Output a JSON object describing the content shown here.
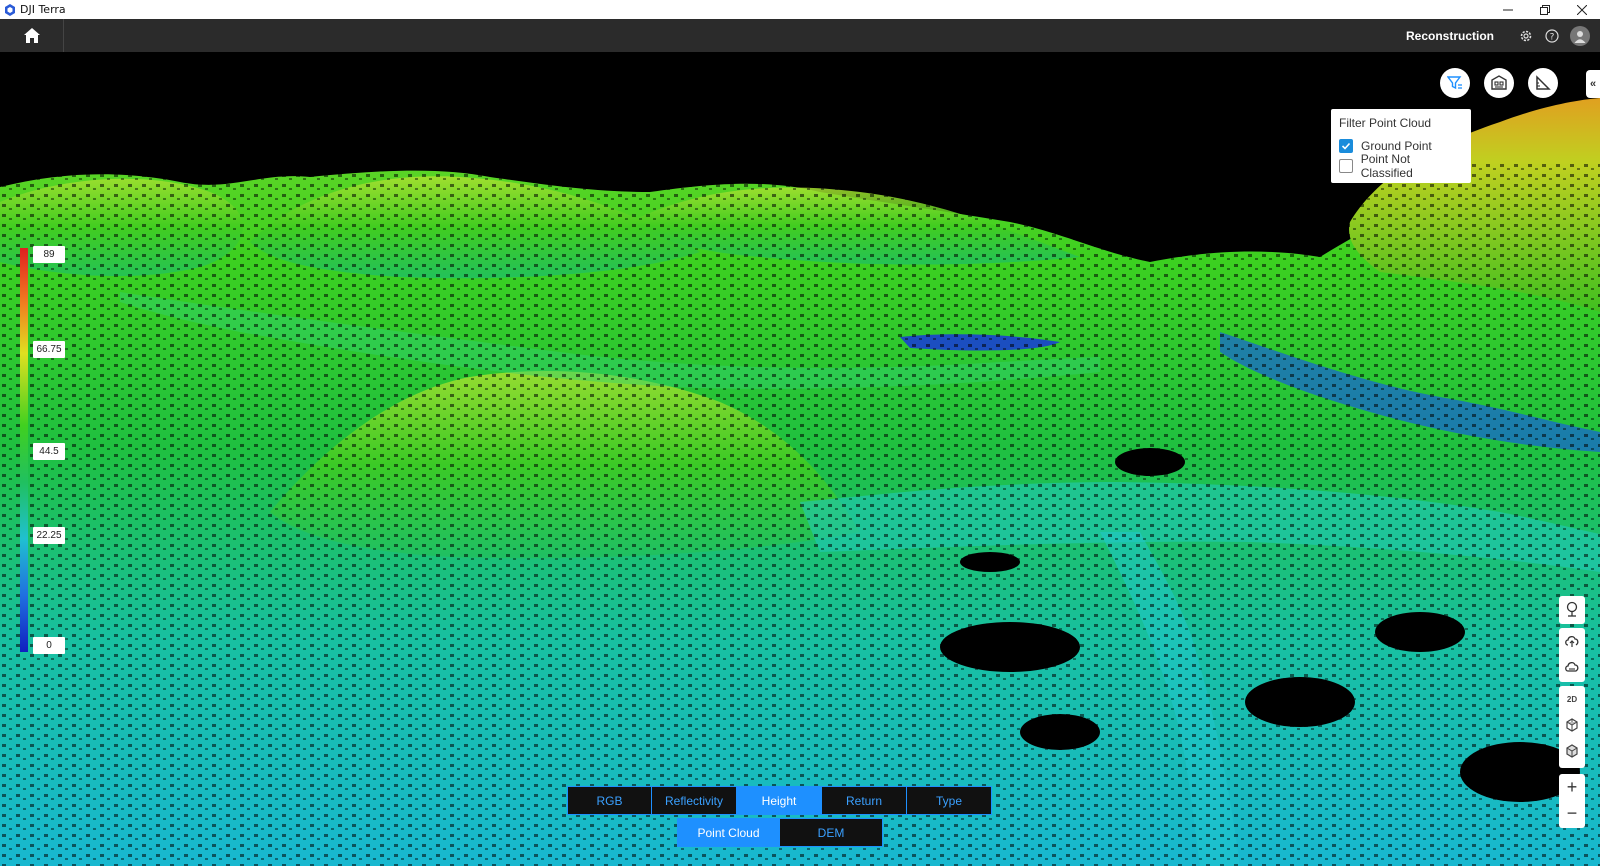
{
  "window": {
    "title": "DJI Terra",
    "icons": [
      "minimize-icon",
      "restore-icon",
      "close-icon"
    ]
  },
  "header": {
    "mode_label": "Reconstruction",
    "icons": [
      "home-icon",
      "settings-icon",
      "help-icon",
      "user-avatar-icon"
    ]
  },
  "toolbar_top": {
    "icons": [
      "filter-icon",
      "building-icon",
      "measure-icon",
      "collapse-icon"
    ],
    "collapse_glyph": "«"
  },
  "filter_panel": {
    "title": "Filter Point Cloud",
    "items": [
      {
        "label": "Ground Point",
        "checked": true
      },
      {
        "label": "Point Not Classified",
        "checked": false
      }
    ]
  },
  "legend": {
    "labels": [
      "89",
      "66.75",
      "44.5",
      "22.25",
      "0"
    ],
    "colors": [
      "#e02020",
      "#f08020",
      "#e0e020",
      "#40d020",
      "#20c060",
      "#20c0d0",
      "#2070e0",
      "#1020c0"
    ]
  },
  "right_toolbar": {
    "group1": [
      "tree-icon",
      "cloud-upload-icon",
      "cloud-download-icon"
    ],
    "group2": {
      "label_2d": "2D",
      "icons": [
        "box-icon",
        "cube-icon"
      ]
    },
    "group3": {
      "zoom_in": "+",
      "zoom_out": "−"
    }
  },
  "color_modes": {
    "items": [
      "RGB",
      "Reflectivity",
      "Height",
      "Return",
      "Type"
    ],
    "active": "Height"
  },
  "view_modes": {
    "items": [
      "Point Cloud",
      "DEM"
    ],
    "active": "Point Cloud"
  }
}
